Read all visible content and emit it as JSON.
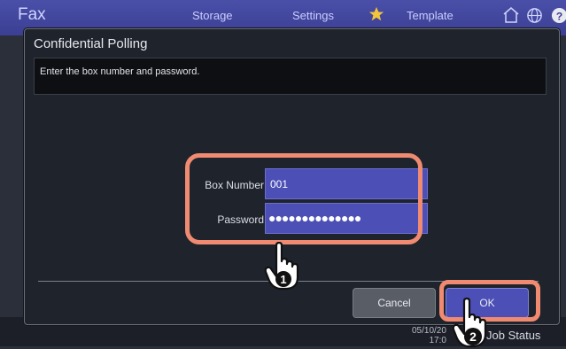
{
  "app": {
    "title": "Fax"
  },
  "topbar": {
    "tabs": [
      "Storage",
      "Settings",
      "Template"
    ]
  },
  "dialog": {
    "title": "Confidential Polling",
    "message": "Enter the box number and password.",
    "fields": {
      "box_number": {
        "label": "Box Number",
        "value": "001"
      },
      "password": {
        "label": "Password",
        "masked_value": "●●●●●●●●●●●●●●"
      }
    },
    "buttons": {
      "cancel": "Cancel",
      "ok": "OK"
    }
  },
  "bottom": {
    "datetime_line1": "05/10/20",
    "datetime_line2": "17:0",
    "job_status": "Job Status"
  },
  "annotations": {
    "step1": "1",
    "step2": "2"
  },
  "colors": {
    "accent_blue": "#4b4fb6",
    "highlight": "#f08b72",
    "dialog_bg": "#1f232c"
  }
}
